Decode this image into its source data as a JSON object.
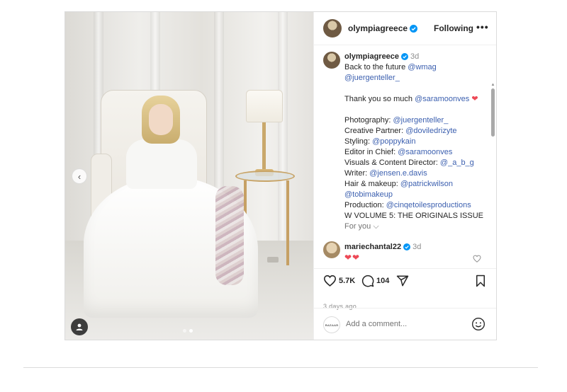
{
  "post": {
    "username": "olympiagreece",
    "follow_label": "Following",
    "more_label": "•••",
    "caption": {
      "username": "olympiagreece",
      "time": "3d",
      "lines": [
        [
          {
            "t": "Back to the future "
          },
          {
            "m": "@wmag"
          }
        ],
        [
          {
            "m": "@juergenteller_"
          }
        ],
        [],
        [
          {
            "t": "Thank you so much "
          },
          {
            "m": "@saramoonves"
          },
          {
            "h": " ❤"
          }
        ],
        [],
        [
          {
            "t": "Photography: "
          },
          {
            "m": "@juergenteller_"
          }
        ],
        [
          {
            "t": "Creative Partner: "
          },
          {
            "m": "@doviledrizyte"
          }
        ],
        [
          {
            "t": "Styling: "
          },
          {
            "m": "@poppykain"
          }
        ],
        [
          {
            "t": "Editor in Chief: "
          },
          {
            "m": "@saramoonves"
          }
        ],
        [
          {
            "t": "Visuals & Content Director: "
          },
          {
            "m": "@_a_b_g"
          }
        ],
        [
          {
            "t": "Writer: "
          },
          {
            "m": "@jensen.e.davis"
          }
        ],
        [
          {
            "t": "Hair & makeup: "
          },
          {
            "m": "@patrickwilson"
          }
        ],
        [
          {
            "m": "@tobimakeup"
          }
        ],
        [
          {
            "t": "Production: "
          },
          {
            "m": "@cinqetoilesproductions"
          }
        ],
        [
          {
            "t": "W VOLUME 5: THE ORIGINALS ISSUE"
          }
        ]
      ]
    },
    "for_you_label": "For you",
    "comment": {
      "username": "mariechantal22",
      "time": "3d",
      "text": "❤❤"
    },
    "likes": "5.7K",
    "comments_count": "104",
    "posted_ago": "3 days ago",
    "commenter_avatar_label": "BAZAAR",
    "add_comment_placeholder": "Add a comment...",
    "carousel": {
      "slide": 2,
      "total": 2
    }
  },
  "colors": {
    "mention": "#3b5faf",
    "verified": "#0095f6",
    "heart": "#ed4956"
  },
  "icons": [
    "verified-badge-icon",
    "more-options-icon",
    "heart-outline-icon",
    "comment-icon",
    "share-icon",
    "bookmark-icon",
    "emoji-icon",
    "chevron-left-icon",
    "chevron-down-icon",
    "user-tag-icon"
  ]
}
